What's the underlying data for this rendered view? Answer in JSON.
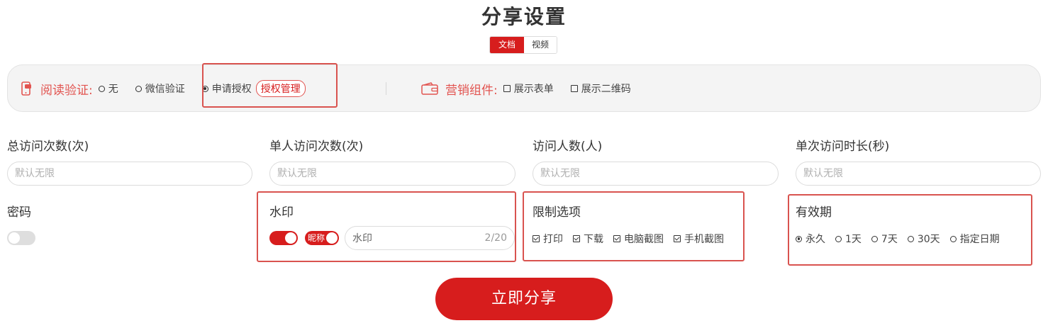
{
  "title": "分享设置",
  "tabs": [
    {
      "label": "文档",
      "active": true
    },
    {
      "label": "视频",
      "active": false
    }
  ],
  "read_verify": {
    "icon": "phone-lock-icon",
    "label": "阅读验证:",
    "options": [
      {
        "label": "无",
        "selected": false
      },
      {
        "label": "微信验证",
        "selected": false
      },
      {
        "label": "申请授权",
        "selected": true
      }
    ],
    "manage_link": "授权管理"
  },
  "marketing": {
    "icon": "wallet-icon",
    "label": "营销组件:",
    "options": [
      {
        "label": "展示表单",
        "checked": false
      },
      {
        "label": "展示二维码",
        "checked": false
      }
    ]
  },
  "fields": [
    {
      "label": "总访问次数(次)",
      "placeholder": "默认无限"
    },
    {
      "label": "单人访问次数(次)",
      "placeholder": "默认无限"
    },
    {
      "label": "访问人数(人)",
      "placeholder": "默认无限"
    },
    {
      "label": "单次访问时长(秒)",
      "placeholder": "默认无限"
    }
  ],
  "password": {
    "label": "密码",
    "enabled": false
  },
  "watermark": {
    "label": "水印",
    "enabled": true,
    "nickname_label": "昵称",
    "nickname_enabled": true,
    "value": "水印",
    "count": "2/20"
  },
  "restrictions": {
    "label": "限制选项",
    "options": [
      {
        "label": "打印",
        "checked": true
      },
      {
        "label": "下载",
        "checked": true
      },
      {
        "label": "电脑截图",
        "checked": true
      },
      {
        "label": "手机截图",
        "checked": true
      }
    ]
  },
  "validity": {
    "label": "有效期",
    "options": [
      {
        "label": "永久",
        "selected": true
      },
      {
        "label": "1天",
        "selected": false
      },
      {
        "label": "7天",
        "selected": false
      },
      {
        "label": "30天",
        "selected": false
      },
      {
        "label": "指定日期",
        "selected": false
      }
    ]
  },
  "share_button": "立即分享",
  "colors": {
    "accent": "#d71d1d",
    "highlight": "#d9534f",
    "label_red": "#e25450"
  }
}
